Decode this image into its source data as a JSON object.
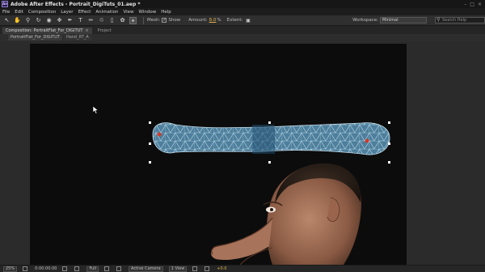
{
  "window": {
    "title": "Adobe After Effects - Portrait_DigiTuts_01.aep *",
    "logo_text": "Ae"
  },
  "menu": [
    "File",
    "Edit",
    "Composition",
    "Layer",
    "Effect",
    "Animation",
    "View",
    "Window",
    "Help"
  ],
  "toolbar": {
    "mesh_label": "Mesh:",
    "show_label": "Show",
    "amount_label": "Amount:",
    "amount_value": "8.0",
    "amount_unit": "%",
    "extent_label": "Extent:",
    "workspace_label": "Workspace:",
    "workspace_value": "Minimal",
    "search_placeholder": "Search Help"
  },
  "panel_tabs": [
    {
      "label": "Composition: PortraitFlat_For_DIGITUT",
      "active": true
    },
    {
      "label": "Project",
      "active": false
    }
  ],
  "sub_tabs": [
    "PortraitFlat_For_DIGITUT",
    "Hand_RT_A"
  ],
  "status_bar": {
    "zoom": "25%",
    "timecode": "0:00:00:00",
    "resolution": "Full",
    "camera": "Active Camera",
    "views": "1 View",
    "exposure": "+0.0"
  },
  "colors": {
    "accent": "#e0b04a",
    "mesh_fill": "#5a8aa8",
    "mesh_line": "#b7d6e6",
    "pin": "#d23a2a"
  }
}
